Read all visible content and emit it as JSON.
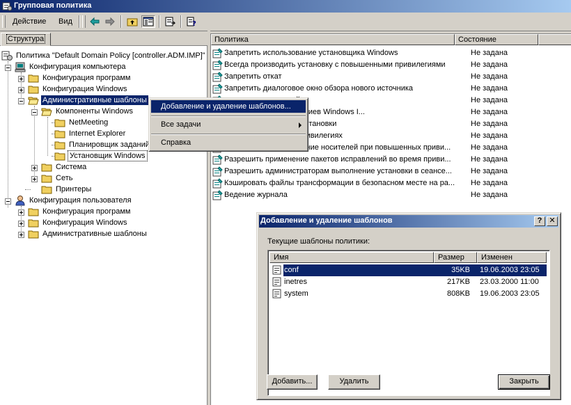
{
  "window": {
    "title": "Групповая политика"
  },
  "menu": {
    "action": "Действие",
    "view": "Вид"
  },
  "toolbar_icons": [
    "back-arrow-icon",
    "forward-arrow-icon",
    "up-folder-icon",
    "show-hide-tree-icon",
    "export-list-icon",
    "help-icon"
  ],
  "tree": {
    "tab_label": "Структура",
    "root": "Политика \"Default Domain Policy [controller.ADM.IMP]\"",
    "computer_config": "Конфигурация компьютера",
    "comp_programs": "Конфигурация программ",
    "comp_windows": "Конфигурация Windows",
    "admin_templates": "Административные шаблоны",
    "windows_components": "Компоненты Windows",
    "netmeeting": "NetMeeting",
    "ie": "Internet Explorer",
    "scheduler": "Планировщик заданий",
    "installer": "Установщик Windows",
    "system": "Система",
    "network": "Сеть",
    "printers": "Принтеры",
    "user_config": "Конфигурация пользователя",
    "user_programs": "Конфигурация программ",
    "user_windows": "Конфигурация Windows",
    "user_admin": "Административные шаблоны"
  },
  "list": {
    "col_policy": "Политика",
    "col_state": "Состояние",
    "rows": [
      {
        "name": "Запретить использование установщика Windows",
        "state": "Не задана"
      },
      {
        "name": "Всегда производить установку с повышенными привилегиями",
        "state": "Не задана"
      },
      {
        "name": "Запретить откат",
        "state": "Не задана"
      },
      {
        "name": "Запретить диалоговое окно обзора нового источника",
        "state": "Не задана"
      },
      {
        "name": "пакетов исправлений",
        "state": "Не задана"
      },
      {
        "name": "пасности IE для сценариев Windows I...",
        "state": "Не задана"
      },
      {
        "name": "изменять параметры установки",
        "state": "Не задана"
      },
      {
        "name": "ва при повышенных привилегиях",
        "state": "Не задана"
      },
      {
        "name": "Разрешить использование носителей при повышенных приви...",
        "state": "Не задана"
      },
      {
        "name": "Разрешить применение пакетов исправлений во время приви...",
        "state": "Не задана"
      },
      {
        "name": "Разрешить администраторам выполнение установки в сеансе...",
        "state": "Не задана"
      },
      {
        "name": "Кэшировать файлы трансформации  в безопасном месте на ра...",
        "state": "Не задана"
      },
      {
        "name": "Ведение журнала",
        "state": "Не задана"
      }
    ]
  },
  "context_menu": {
    "add_remove": "Добавление и удаление шаблонов...",
    "all_tasks": "Все задачи",
    "help": "Справка"
  },
  "dialog": {
    "title": "Добавление и удаление шаблонов",
    "help_btn": "?",
    "close_btn": "✕",
    "label": "Текущие шаблоны политики:",
    "col_name": "Имя",
    "col_size": "Размер",
    "col_modified": "Изменен",
    "files": [
      {
        "name": "conf",
        "size": "35KB",
        "modified": "19.06.2003 23:05"
      },
      {
        "name": "inetres",
        "size": "217KB",
        "modified": "23.03.2000 11:00"
      },
      {
        "name": "system",
        "size": "808KB",
        "modified": "19.06.2003 23:05"
      }
    ],
    "add": "Добавить...",
    "remove": "Удалить",
    "close": "Закрыть"
  },
  "colors": {
    "selection": "#0a246a",
    "face": "#d4d0c8",
    "folder": "#f0d060"
  }
}
